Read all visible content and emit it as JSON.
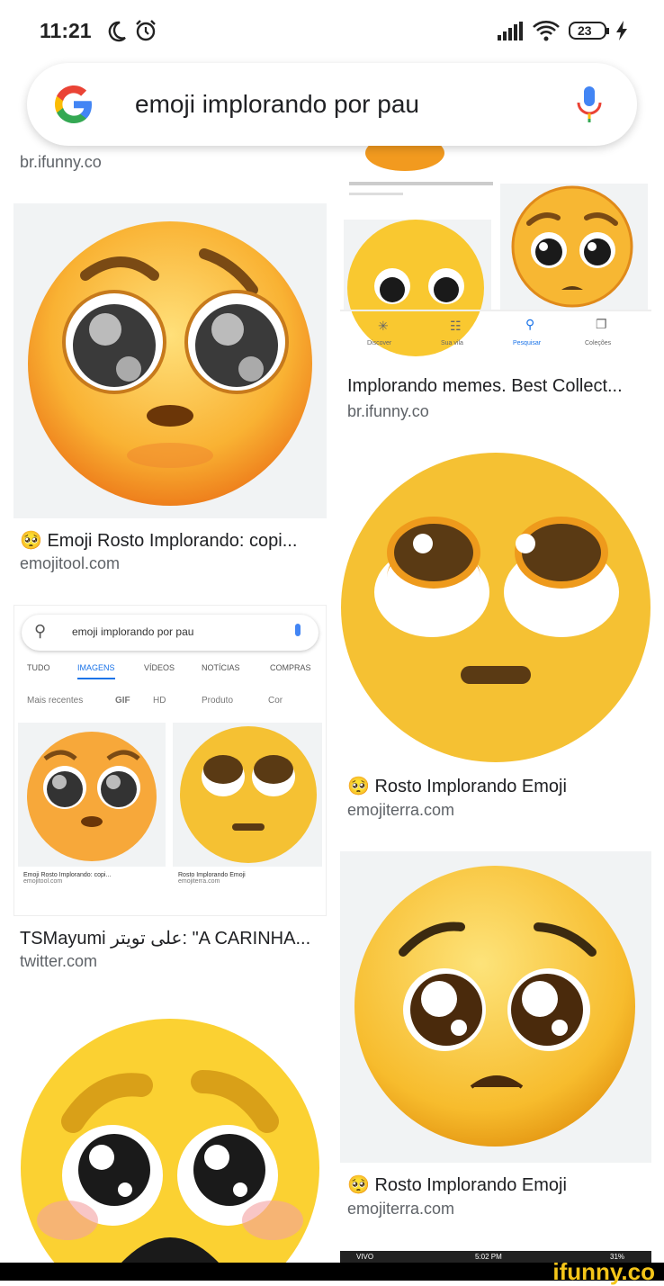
{
  "status": {
    "time": "11:21",
    "battery": "23",
    "icons": [
      "moon-icon",
      "alarm-icon",
      "signal-icon",
      "wifi-icon",
      "battery-icon",
      "charging-icon"
    ]
  },
  "search": {
    "query": "emoji implorando por pau",
    "icons": [
      "google-logo",
      "mic-icon"
    ]
  },
  "results": {
    "left": [
      {
        "source_top": "br.ifunny.co"
      },
      {
        "title": "Emoji Rosto Implorando: copi...",
        "source": "emojitool.com"
      },
      {
        "title": "TSMayumi على تويتر: \"A CARINHA...",
        "source": "twitter.com",
        "inner": {
          "query": "emoji implorando por pau",
          "tabs": [
            "TUDO",
            "IMAGENS",
            "VÍDEOS",
            "NOTÍCIAS",
            "COMPRAS"
          ],
          "filters": [
            "Mais recentes",
            "GIF",
            "HD",
            "Produto",
            "Cor"
          ],
          "cap1": "Emoji Rosto Implorando: copi...",
          "src1": "emojitool.com",
          "cap2": "Rosto Implorando Emoji",
          "src2": "emojiterra.com"
        }
      }
    ],
    "right": [
      {
        "title": "Implorando memes. Best Collect...",
        "source": "br.ifunny.co",
        "nav": [
          "Discover",
          "Sua vila",
          "Pesquisar",
          "Coleções"
        ]
      },
      {
        "title": "Rosto Implorando Emoji",
        "source": "emojiterra.com"
      },
      {
        "title": "Rosto Implorando Emoji",
        "source": "emojiterra.com"
      }
    ],
    "bottom_status": {
      "carrier": "VIVO",
      "time": "5:02 PM",
      "battery": "31%"
    }
  },
  "watermark": "ifunny.co",
  "colors": {
    "emoji_yellow": "#f5c133",
    "emoji_orange": "#f29a1f",
    "google_blue": "#4285f4"
  }
}
